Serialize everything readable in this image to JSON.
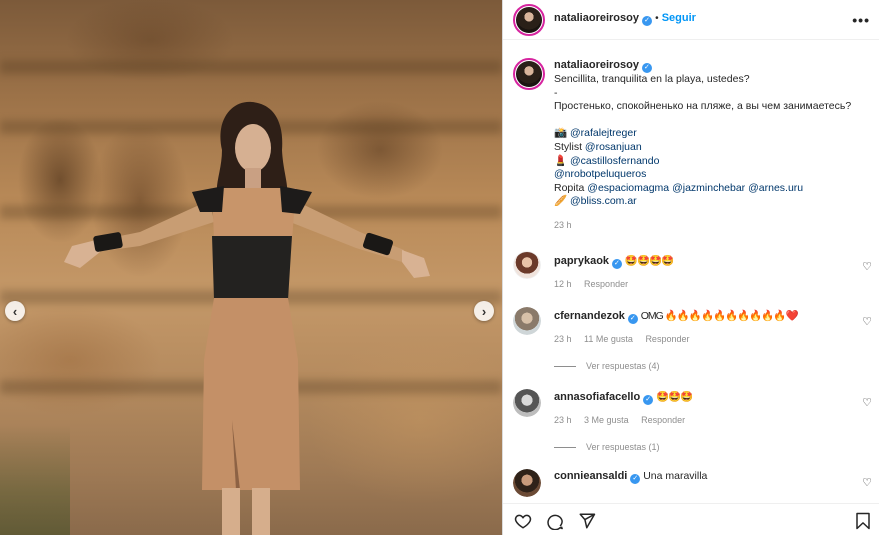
{
  "post": {
    "username": "nataliaoreirosoy",
    "follow_label": "Seguir",
    "separator": "•",
    "more_label": "•••"
  },
  "caption": {
    "username": "nataliaoreirosoy",
    "lines": [
      "Sencillita, tranquilita en la playa, ustedes?",
      "-",
      "Простенько, спокойненько на пляже, а вы чем занимаетесь?"
    ],
    "credits": [
      {
        "prefix": "📸 ",
        "text": "@rafalejtreger"
      },
      {
        "prefix": "Stylist ",
        "text": "@rosanjuan"
      },
      {
        "prefix": "💄 ",
        "text": "@castillosfernando"
      },
      {
        "prefix": "",
        "text": "@nrobotpeluqueros"
      }
    ],
    "ropita_prefix": "Ropita ",
    "ropita": [
      "@espaciomagma",
      "@jazminchebar",
      "@arnes.uru"
    ],
    "bliss_prefix": "🥖 ",
    "bliss": "@bliss.com.ar",
    "time": "23 h"
  },
  "comments": [
    {
      "username": "paprykaok",
      "text": "🤩🤩🤩🤩",
      "time": "12 h",
      "likes": "",
      "reply": "Responder",
      "replies": ""
    },
    {
      "username": "cfernandezok",
      "text": "OMG 🔥🔥🔥🔥🔥🔥🔥🔥🔥🔥❤️",
      "time": "23 h",
      "likes": "11 Me gusta",
      "reply": "Responder",
      "replies": "Ver respuestas (4)"
    },
    {
      "username": "annasofiafacello",
      "text": "🤩🤩🤩",
      "time": "23 h",
      "likes": "3 Me gusta",
      "reply": "Responder",
      "replies": "Ver respuestas (1)"
    },
    {
      "username": "connieansaldi",
      "text": "Una maravilla",
      "time": "",
      "likes": "",
      "reply": "",
      "replies": ""
    }
  ],
  "icons": {
    "like": "heart-icon",
    "comment": "comment-icon",
    "share": "share-icon",
    "save": "bookmark-icon",
    "prev": "chevron-left-icon",
    "next": "chevron-right-icon"
  }
}
